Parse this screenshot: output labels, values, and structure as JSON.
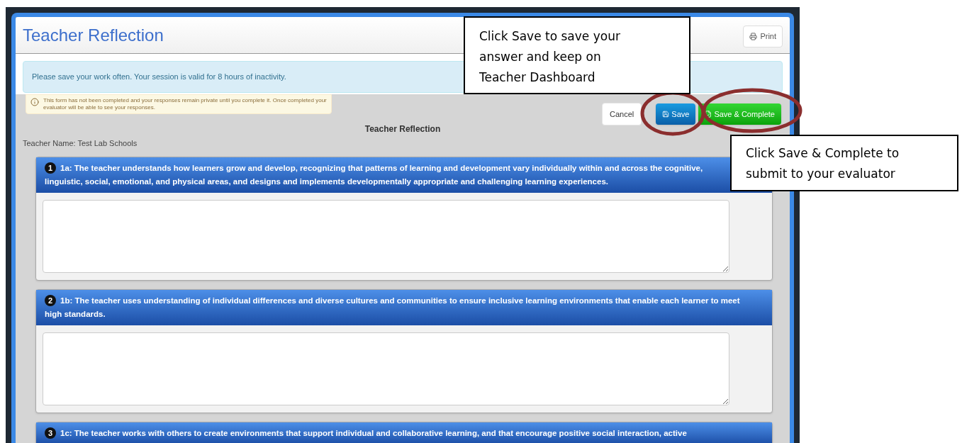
{
  "page": {
    "title": "Teacher Reflection",
    "print_button": "Print"
  },
  "session_notice": "Please save your work often. Your session is valid for 8 hours of inactivity.",
  "form_notice": "This form has not been completed and your responses remain private until you complete it. Once completed your evaluator will be able to see your responses.",
  "actions": {
    "cancel": "Cancel",
    "save": "Save",
    "save_complete": "Save & Complete"
  },
  "form_title": "Teacher Reflection",
  "teacher_name": "Teacher Name: Test Lab Schools",
  "questions": [
    {
      "number": "1",
      "text": "1a: The teacher understands how learners grow and develop, recognizing that patterns of learning and development vary individually within and across the cognitive, linguistic, social, emotional, and physical areas, and designs and implements developmentally appropriate and challenging learning experiences."
    },
    {
      "number": "2",
      "text": "1b: The teacher uses understanding of individual differences and diverse cultures and communities to ensure inclusive learning environments that enable each learner to meet high standards."
    },
    {
      "number": "3",
      "text": "1c: The teacher works with others to create environments that support individual and collaborative learning, and that encourage positive social interaction, active"
    }
  ],
  "annotations": [
    "Click Save to save your answer and keep on Teacher Dashboard",
    "Click Save & Complete to submit to your evaluator"
  ]
}
